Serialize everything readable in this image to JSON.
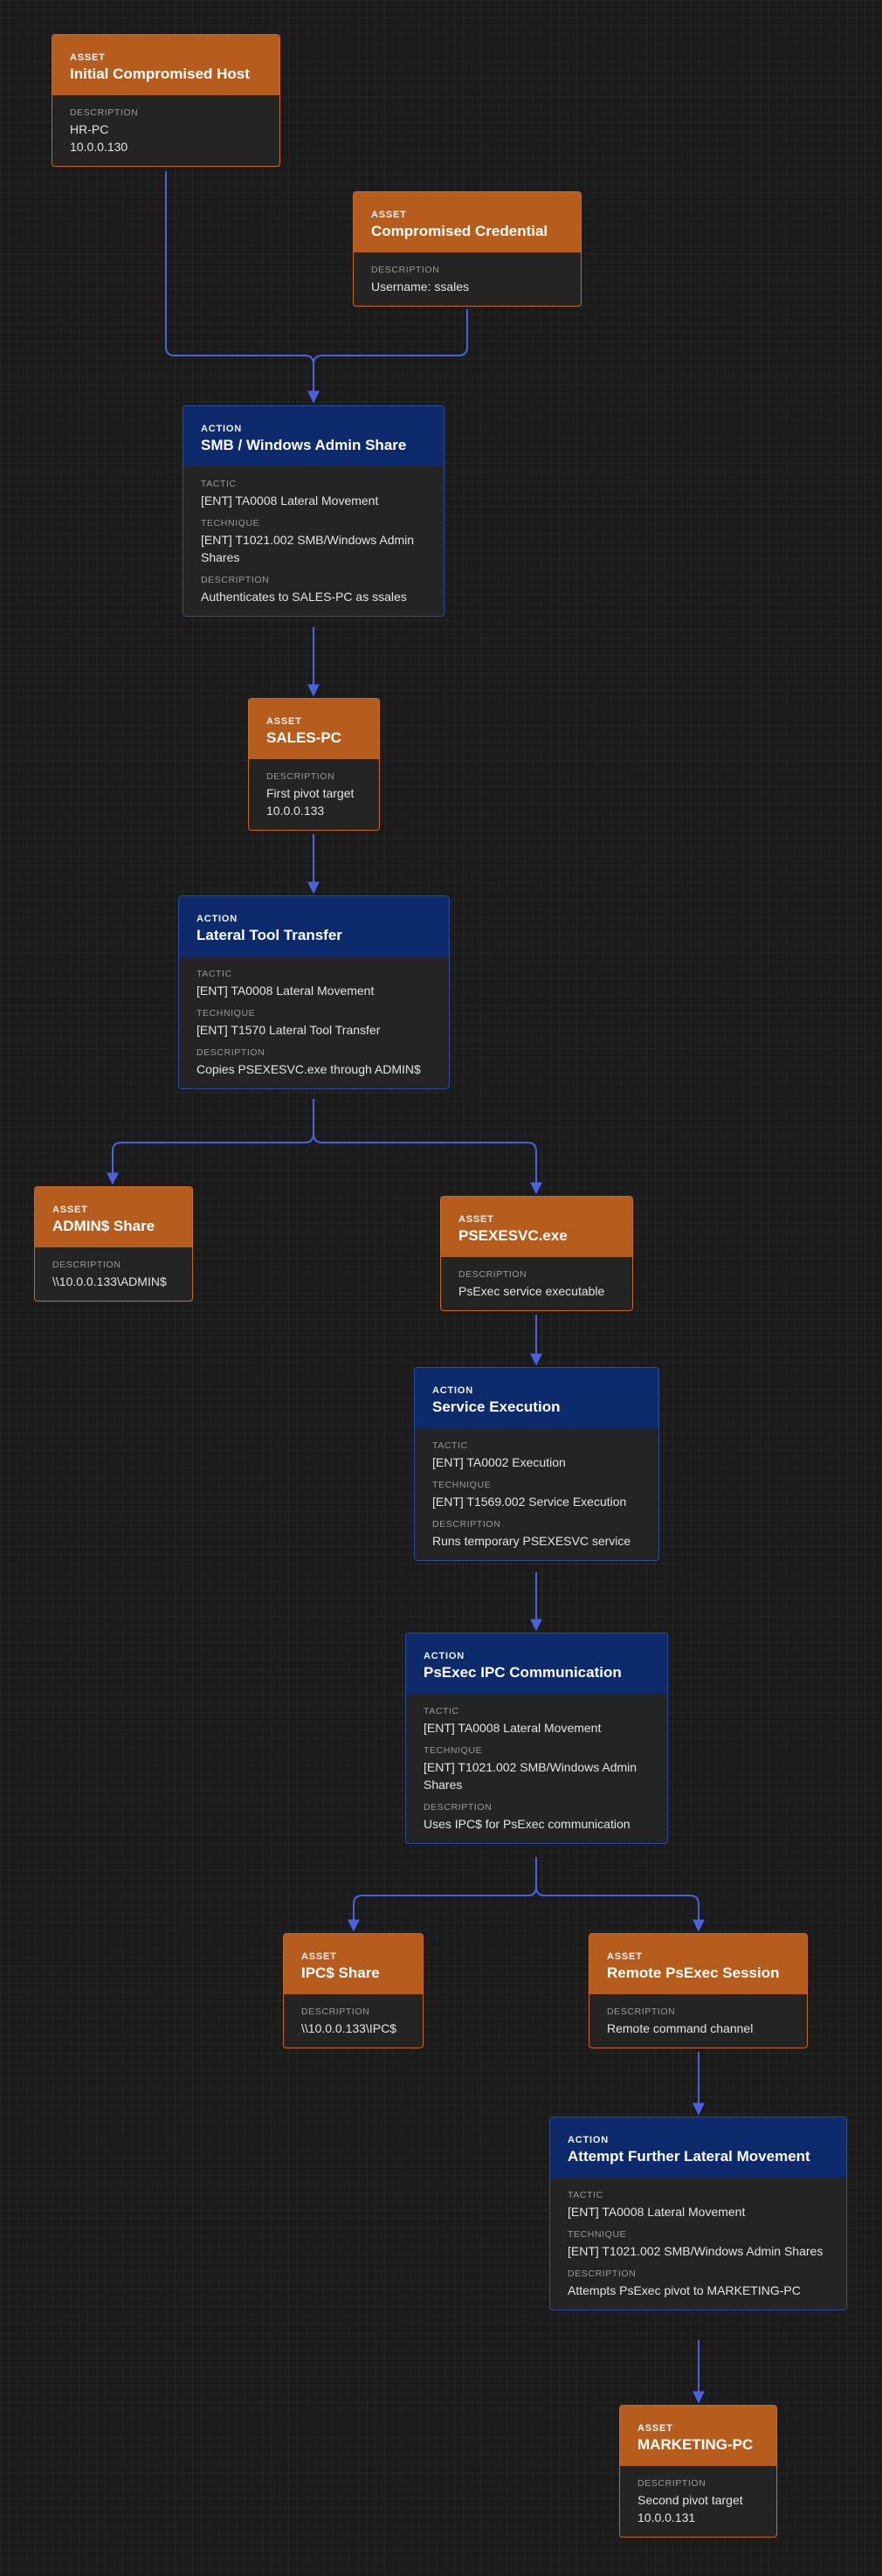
{
  "colors": {
    "asset_header": "#b65d1e",
    "action_header": "#0c2a6c",
    "edge": "#4a62e0",
    "background": "#1b1b1b"
  },
  "nodes": {
    "initial_host": {
      "kind": "ASSET",
      "title": "Initial Compromised Host",
      "description_label": "DESCRIPTION",
      "description": "HR-PC\n10.0.0.130"
    },
    "compromised_credential": {
      "kind": "ASSET",
      "title": "Compromised Credential",
      "description_label": "DESCRIPTION",
      "description": "Username: ssales"
    },
    "smb_admin_share": {
      "kind": "ACTION",
      "title": "SMB / Windows Admin Share",
      "tactic_label": "TACTIC",
      "tactic": "[ENT] TA0008 Lateral Movement",
      "technique_label": "TECHNIQUE",
      "technique": "[ENT] T1021.002 SMB/Windows Admin Shares",
      "description_label": "DESCRIPTION",
      "description": "Authenticates to SALES-PC as ssales"
    },
    "sales_pc": {
      "kind": "ASSET",
      "title": "SALES-PC",
      "description_label": "DESCRIPTION",
      "description": "First pivot target\n10.0.0.133"
    },
    "lateral_tool_transfer": {
      "kind": "ACTION",
      "title": "Lateral Tool Transfer",
      "tactic_label": "TACTIC",
      "tactic": "[ENT] TA0008 Lateral Movement",
      "technique_label": "TECHNIQUE",
      "technique": "[ENT] T1570 Lateral Tool Transfer",
      "description_label": "DESCRIPTION",
      "description": "Copies PSEXESVC.exe through ADMIN$"
    },
    "admin_share": {
      "kind": "ASSET",
      "title": "ADMIN$ Share",
      "description_label": "DESCRIPTION",
      "description": "\\\\10.0.0.133\\ADMIN$"
    },
    "psexesvc": {
      "kind": "ASSET",
      "title": "PSEXESVC.exe",
      "description_label": "DESCRIPTION",
      "description": "PsExec service executable"
    },
    "service_execution": {
      "kind": "ACTION",
      "title": "Service Execution",
      "tactic_label": "TACTIC",
      "tactic": "[ENT] TA0002 Execution",
      "technique_label": "TECHNIQUE",
      "technique": "[ENT] T1569.002 Service Execution",
      "description_label": "DESCRIPTION",
      "description": "Runs temporary PSEXESVC service"
    },
    "psexec_ipc": {
      "kind": "ACTION",
      "title": "PsExec IPC Communication",
      "tactic_label": "TACTIC",
      "tactic": "[ENT] TA0008 Lateral Movement",
      "technique_label": "TECHNIQUE",
      "technique": "[ENT] T1021.002 SMB/Windows Admin Shares",
      "description_label": "DESCRIPTION",
      "description": "Uses IPC$ for PsExec communication"
    },
    "ipc_share": {
      "kind": "ASSET",
      "title": "IPC$ Share",
      "description_label": "DESCRIPTION",
      "description": "\\\\10.0.0.133\\IPC$"
    },
    "remote_psexec_session": {
      "kind": "ASSET",
      "title": "Remote PsExec Session",
      "description_label": "DESCRIPTION",
      "description": "Remote command channel"
    },
    "further_lateral": {
      "kind": "ACTION",
      "title": "Attempt Further Lateral Movement",
      "tactic_label": "TACTIC",
      "tactic": "[ENT] TA0008 Lateral Movement",
      "technique_label": "TECHNIQUE",
      "technique": "[ENT] T1021.002 SMB/Windows Admin Shares",
      "description_label": "DESCRIPTION",
      "description": "Attempts PsExec pivot to MARKETING-PC"
    },
    "marketing_pc": {
      "kind": "ASSET",
      "title": "MARKETING-PC",
      "description_label": "DESCRIPTION",
      "description": "Second pivot target\n10.0.0.131"
    }
  }
}
